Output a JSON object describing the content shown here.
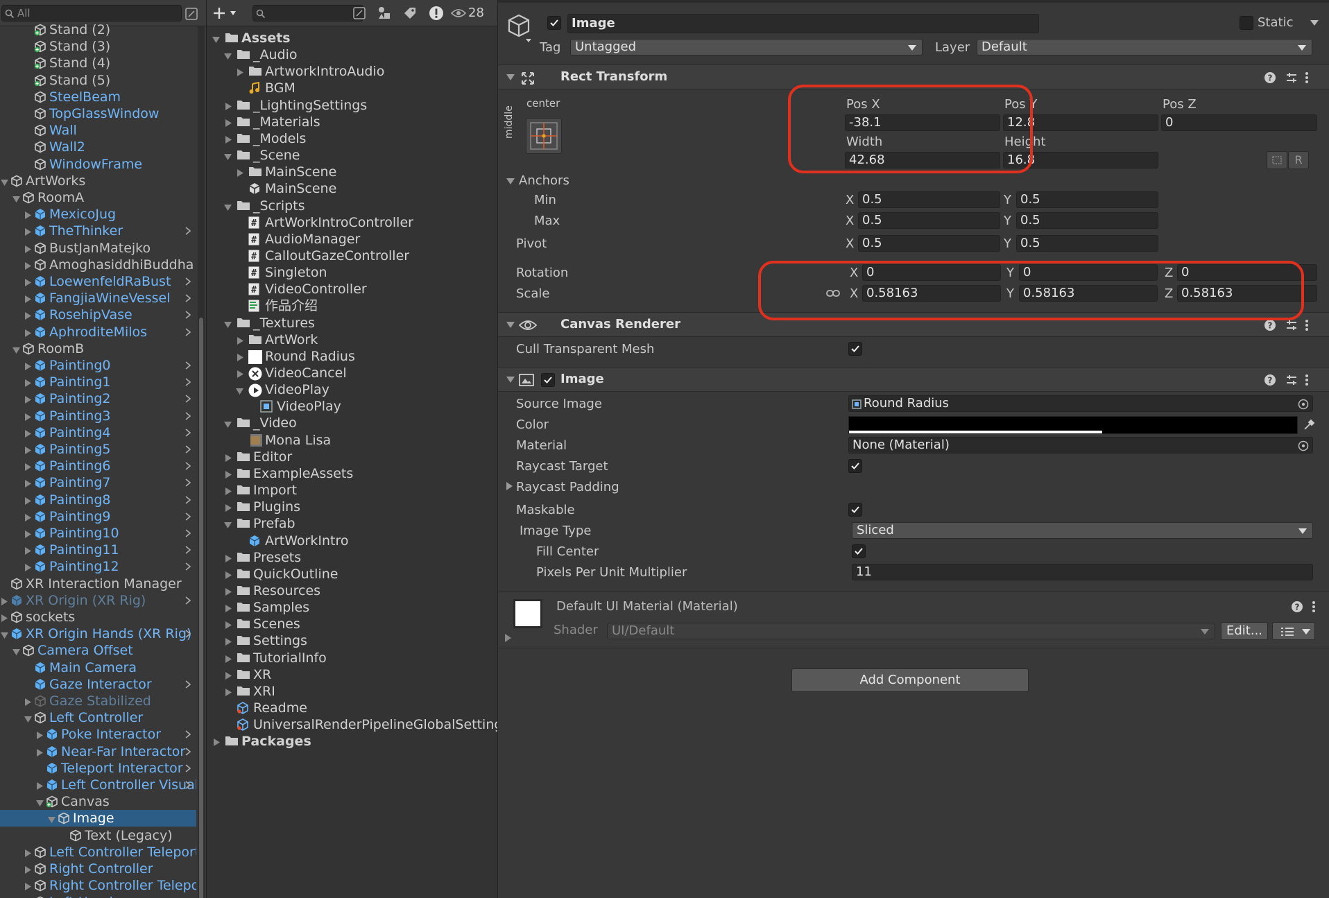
{
  "hierarchy": {
    "search_placeholder": "All",
    "items": [
      {
        "label": "Stand (2)",
        "style": "white"
      },
      {
        "label": "Stand (3)",
        "style": "white"
      },
      {
        "label": "Stand (4)",
        "style": "white"
      },
      {
        "label": "Stand (5)",
        "style": "white"
      },
      {
        "label": "SteelBeam",
        "style": "blue"
      },
      {
        "label": "TopGlassWindow",
        "style": "blue"
      },
      {
        "label": "Wall",
        "style": "blue"
      },
      {
        "label": "Wall2",
        "style": "blue"
      },
      {
        "label": "WindowFrame",
        "style": "blue"
      },
      {
        "label": "ArtWorks",
        "style": "white"
      },
      {
        "label": "RoomA",
        "style": "white"
      },
      {
        "label": "MexicoJug",
        "style": "blue"
      },
      {
        "label": "TheThinker",
        "style": "blue"
      },
      {
        "label": "BustJanMatejko",
        "style": "white"
      },
      {
        "label": "AmoghasiddhiBuddha",
        "style": "white"
      },
      {
        "label": "LoewenfeldRaBust",
        "style": "blue"
      },
      {
        "label": "FangjiaWineVessel",
        "style": "blue"
      },
      {
        "label": "RosehipVase",
        "style": "blue"
      },
      {
        "label": "AphroditeMilos",
        "style": "blue"
      },
      {
        "label": "RoomB",
        "style": "white"
      },
      {
        "label": "Painting0",
        "style": "blue"
      },
      {
        "label": "Painting1",
        "style": "blue"
      },
      {
        "label": "Painting2",
        "style": "blue"
      },
      {
        "label": "Painting3",
        "style": "blue"
      },
      {
        "label": "Painting4",
        "style": "blue"
      },
      {
        "label": "Painting5",
        "style": "blue"
      },
      {
        "label": "Painting6",
        "style": "blue"
      },
      {
        "label": "Painting7",
        "style": "blue"
      },
      {
        "label": "Painting8",
        "style": "blue"
      },
      {
        "label": "Painting9",
        "style": "blue"
      },
      {
        "label": "Painting10",
        "style": "blue"
      },
      {
        "label": "Painting11",
        "style": "blue"
      },
      {
        "label": "Painting12",
        "style": "blue"
      },
      {
        "label": "XR Interaction Manager",
        "style": "white"
      },
      {
        "label": "XR Origin (XR Rig)",
        "style": "dim"
      },
      {
        "label": "sockets",
        "style": "white"
      },
      {
        "label": "XR Origin Hands (XR Rig)",
        "style": "blue"
      },
      {
        "label": "Camera Offset",
        "style": "blue"
      },
      {
        "label": "Main Camera",
        "style": "blue"
      },
      {
        "label": "Gaze Interactor",
        "style": "blue"
      },
      {
        "label": "Gaze Stabilized",
        "style": "dim"
      },
      {
        "label": "Left Controller",
        "style": "blue"
      },
      {
        "label": "Poke Interactor",
        "style": "blue"
      },
      {
        "label": "Near-Far Interactor",
        "style": "blue"
      },
      {
        "label": "Teleport Interactor",
        "style": "blue"
      },
      {
        "label": "Left Controller Visual",
        "style": "blue"
      },
      {
        "label": "Canvas",
        "style": "white"
      },
      {
        "label": "Image",
        "style": "white"
      },
      {
        "label": "Text (Legacy)",
        "style": "white"
      },
      {
        "label": "Left Controller Teleport",
        "style": "blue"
      },
      {
        "label": "Right Controller",
        "style": "blue"
      },
      {
        "label": "Right Controller Teleport",
        "style": "blue"
      },
      {
        "label": "Left Hand",
        "style": "blue"
      }
    ]
  },
  "project": {
    "visible_count": "28",
    "items": [
      {
        "label": "Assets",
        "icon": "folder"
      },
      {
        "label": "_Audio",
        "icon": "folder"
      },
      {
        "label": "ArtworkIntroAudio",
        "icon": "folder"
      },
      {
        "label": "BGM",
        "icon": "audio"
      },
      {
        "label": "_LightingSettings",
        "icon": "folder"
      },
      {
        "label": "_Materials",
        "icon": "folder"
      },
      {
        "label": "_Models",
        "icon": "folder"
      },
      {
        "label": "_Scene",
        "icon": "folder"
      },
      {
        "label": "MainScene",
        "icon": "folder"
      },
      {
        "label": "MainScene",
        "icon": "unity"
      },
      {
        "label": "_Scripts",
        "icon": "folder"
      },
      {
        "label": "ArtWorkIntroController",
        "icon": "script"
      },
      {
        "label": "AudioManager",
        "icon": "script"
      },
      {
        "label": "CalloutGazeController",
        "icon": "script"
      },
      {
        "label": "Singleton",
        "icon": "script"
      },
      {
        "label": "VideoController",
        "icon": "script"
      },
      {
        "label": "作品介绍",
        "icon": "script-green"
      },
      {
        "label": "_Textures",
        "icon": "folder"
      },
      {
        "label": "ArtWork",
        "icon": "folder"
      },
      {
        "label": "Round Radius",
        "icon": "white-square"
      },
      {
        "label": "VideoCancel",
        "icon": "circle-x"
      },
      {
        "label": "VideoPlay",
        "icon": "circle-play"
      },
      {
        "label": "VideoPlay",
        "icon": "sprite"
      },
      {
        "label": "_Video",
        "icon": "folder"
      },
      {
        "label": "Mona Lisa",
        "icon": "video"
      },
      {
        "label": "Editor",
        "icon": "folder"
      },
      {
        "label": "ExampleAssets",
        "icon": "folder"
      },
      {
        "label": "Import",
        "icon": "folder"
      },
      {
        "label": "Plugins",
        "icon": "folder"
      },
      {
        "label": "Prefab",
        "icon": "folder"
      },
      {
        "label": "ArtWorkIntro",
        "icon": "prefab"
      },
      {
        "label": "Presets",
        "icon": "folder"
      },
      {
        "label": "QuickOutline",
        "icon": "folder"
      },
      {
        "label": "Resources",
        "icon": "folder"
      },
      {
        "label": "Samples",
        "icon": "folder"
      },
      {
        "label": "Scenes",
        "icon": "folder"
      },
      {
        "label": "Settings",
        "icon": "folder"
      },
      {
        "label": "TutorialInfo",
        "icon": "folder"
      },
      {
        "label": "XR",
        "icon": "folder"
      },
      {
        "label": "XRI",
        "icon": "folder"
      },
      {
        "label": "Readme",
        "icon": "asset"
      },
      {
        "label": "UniversalRenderPipelineGlobalSettings",
        "icon": "asset"
      },
      {
        "label": "Packages",
        "icon": "folder"
      }
    ]
  },
  "inspector": {
    "object_name": "Image",
    "static_label": "Static",
    "tag_label": "Tag",
    "tag_value": "Untagged",
    "layer_label": "Layer",
    "layer_value": "Default",
    "rect_transform": {
      "title": "Rect Transform",
      "anchor_h": "center",
      "anchor_v": "middle",
      "pos_x_label": "Pos X",
      "pos_y_label": "Pos Y",
      "pos_z_label": "Pos Z",
      "pos_x": "-38.1",
      "pos_y": "12.8",
      "pos_z": "0",
      "width_label": "Width",
      "height_label": "Height",
      "width": "42.68",
      "height": "16.8",
      "r_button": "R",
      "anchors_label": "Anchors",
      "min_label": "Min",
      "max_label": "Max",
      "min_x": "0.5",
      "min_y": "0.5",
      "max_x": "0.5",
      "max_y": "0.5",
      "pivot_label": "Pivot",
      "pivot_x": "0.5",
      "pivot_y": "0.5",
      "rotation_label": "Rotation",
      "rot_x": "0",
      "rot_y": "0",
      "rot_z": "0",
      "scale_label": "Scale",
      "scale_x": "0.58163",
      "scale_y": "0.58163",
      "scale_z": "0.58163",
      "x": "X",
      "y": "Y",
      "z": "Z"
    },
    "canvas_renderer": {
      "title": "Canvas Renderer",
      "cull_label": "Cull Transparent Mesh"
    },
    "image": {
      "title": "Image",
      "source_label": "Source Image",
      "source_value": "Round Radius",
      "color_label": "Color",
      "material_label": "Material",
      "material_value": "None (Material)",
      "raycast_target_label": "Raycast Target",
      "raycast_padding_label": "Raycast Padding",
      "maskable_label": "Maskable",
      "image_type_label": "Image Type",
      "image_type_value": "Sliced",
      "fill_center_label": "Fill Center",
      "ppu_label": "Pixels Per Unit Multiplier",
      "ppu_value": "11"
    },
    "material": {
      "title": "Default UI Material (Material)",
      "shader_label": "Shader",
      "shader_value": "UI/Default",
      "edit_button": "Edit..."
    },
    "add_component": "Add Component"
  },
  "colors": {
    "highlight": "#e0311f",
    "selection": "#2c5d87",
    "link_blue": "#6fb5f7"
  }
}
